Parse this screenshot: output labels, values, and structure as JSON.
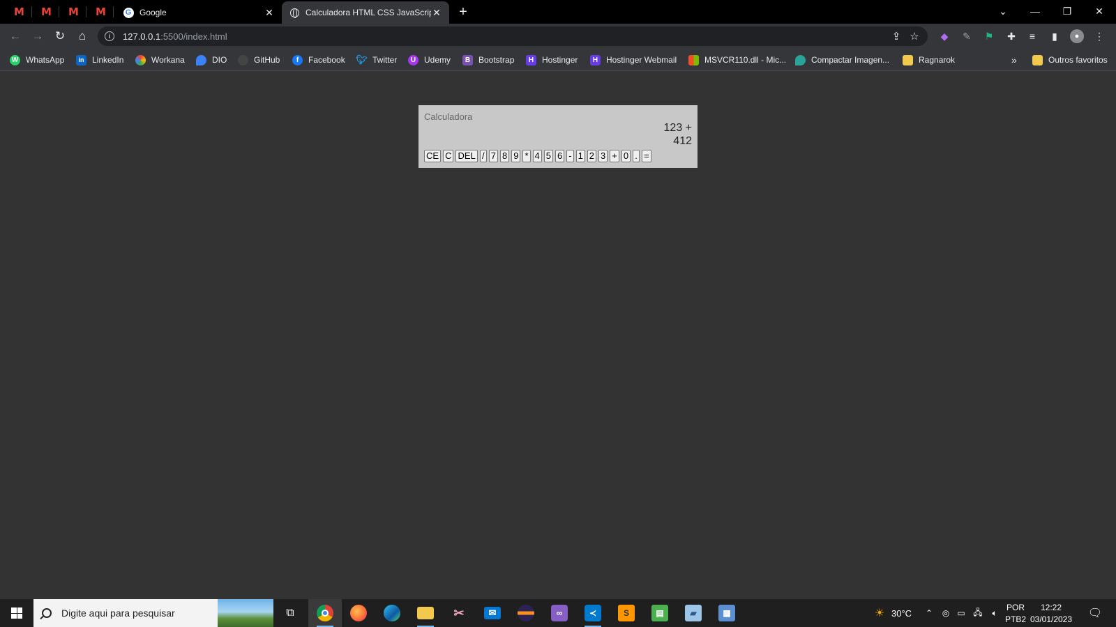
{
  "browser": {
    "tabs": [
      {
        "title": "Google",
        "active": false
      },
      {
        "title": "Calculadora HTML CSS JavaScript",
        "active": true
      }
    ],
    "pinned_tab_letter": "M",
    "url_host": "127.0.0.1",
    "url_rest": ":5500/index.html"
  },
  "bookmarks": [
    {
      "label": "WhatsApp",
      "icon": "whatsapp-icon",
      "color": "#25d366",
      "glyph": "W"
    },
    {
      "label": "LinkedIn",
      "icon": "linkedin-icon",
      "color": "#0a66c2",
      "glyph": "in"
    },
    {
      "label": "Workana",
      "icon": "workana-icon",
      "color": "#e8453c",
      "glyph": "W"
    },
    {
      "label": "DIO",
      "icon": "dio-icon",
      "color": "#3b82f6",
      "glyph": "D"
    },
    {
      "label": "GitHub",
      "icon": "github-icon",
      "color": "#444444",
      "glyph": "G"
    },
    {
      "label": "Facebook",
      "icon": "facebook-icon",
      "color": "#1877f2",
      "glyph": "f"
    },
    {
      "label": "Twitter",
      "icon": "twitter-icon",
      "color": "#1d9bf0",
      "glyph": "t"
    },
    {
      "label": "Udemy",
      "icon": "udemy-icon",
      "color": "#a435f0",
      "glyph": "U"
    },
    {
      "label": "Bootstrap",
      "icon": "bootstrap-icon",
      "color": "#7952b3",
      "glyph": "B"
    },
    {
      "label": "Hostinger",
      "icon": "hostinger-icon",
      "color": "#673de6",
      "glyph": "H"
    },
    {
      "label": "Hostinger Webmail",
      "icon": "hostinger-icon",
      "color": "#673de6",
      "glyph": "H"
    },
    {
      "label": "MSVCR110.dll - Mic...",
      "icon": "microsoft-icon",
      "color": "#f25022",
      "glyph": "▦"
    },
    {
      "label": "Compactar Imagen...",
      "icon": "compress-icon",
      "color": "#2aa39a",
      "glyph": "C"
    },
    {
      "label": "Ragnarok",
      "icon": "folder-icon",
      "color": "#f2c94c",
      "glyph": ""
    }
  ],
  "bookmarks_overflow": "»",
  "other_bookmarks": "Outros favoritos",
  "calculator": {
    "title": "Calculadora",
    "previous": "123 +",
    "current": "412",
    "keys": [
      "CE",
      "C",
      "DEL",
      "/",
      "7",
      "8",
      "9",
      "*",
      "4",
      "5",
      "6",
      "-",
      "1",
      "2",
      "3",
      "+",
      "0",
      ".",
      "="
    ]
  },
  "taskbar": {
    "search_placeholder": "Digite aqui para pesquisar",
    "weather": "30°C",
    "lang_top": "POR",
    "lang_bottom": "PTB2",
    "time": "12:22",
    "date": "03/01/2023"
  }
}
